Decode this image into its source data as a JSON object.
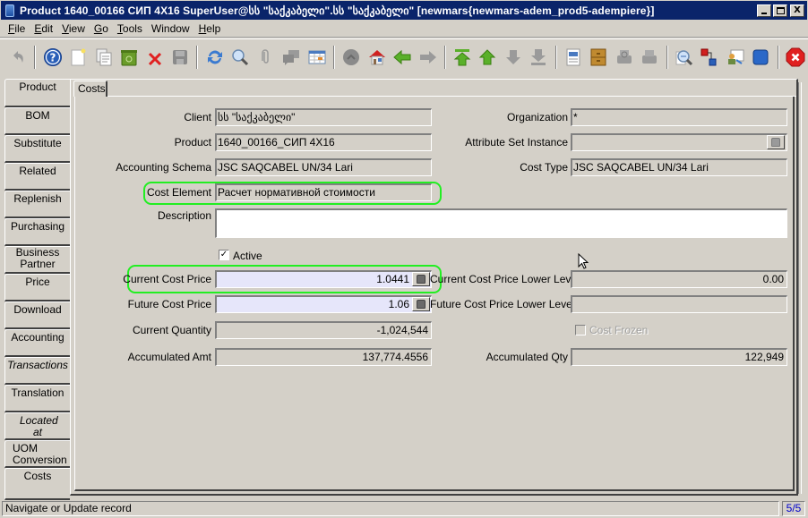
{
  "window": {
    "title": "Product  1640_00166  СИП 4X16  SuperUser@სს \"საქკაბელი\".სს \"საქკაბელი\" [newmars{newmars-adem_prod5-adempiere}]",
    "minimize": "_",
    "maximize": "□",
    "close": "X"
  },
  "menu": [
    {
      "label": "File",
      "mnemonic": "F",
      "rest": "ile"
    },
    {
      "label": "Edit",
      "mnemonic": "E",
      "rest": "dit"
    },
    {
      "label": "View",
      "mnemonic": "V",
      "rest": "iew"
    },
    {
      "label": "Go",
      "mnemonic": "G",
      "rest": "o"
    },
    {
      "label": "Tools",
      "mnemonic": "T",
      "rest": "ools"
    },
    {
      "label": "Window",
      "mnemonic": "",
      "rest": "Window"
    },
    {
      "label": "Help",
      "mnemonic": "H",
      "rest": "elp"
    }
  ],
  "toolbar": [
    {
      "icon": "undo-icon",
      "enabled": false
    },
    {
      "icon": "help-icon",
      "enabled": true
    },
    {
      "icon": "new-record-icon",
      "enabled": true
    },
    {
      "icon": "copy-record-icon",
      "enabled": true
    },
    {
      "icon": "delete-icon",
      "enabled": true
    },
    {
      "icon": "delete-selection-icon",
      "enabled": true
    },
    {
      "icon": "save-icon",
      "enabled": false
    },
    {
      "icon": "refresh-icon",
      "enabled": true
    },
    {
      "icon": "find-icon",
      "enabled": true
    },
    {
      "icon": "attachment-icon",
      "enabled": false
    },
    {
      "icon": "chat-icon",
      "enabled": false
    },
    {
      "icon": "grid-toggle-icon",
      "enabled": true
    },
    {
      "icon": "history-icon",
      "enabled": false
    },
    {
      "icon": "home-icon",
      "enabled": true
    },
    {
      "icon": "parent-icon",
      "enabled": true
    },
    {
      "icon": "detail-icon",
      "enabled": false
    },
    {
      "icon": "first-record-icon",
      "enabled": true
    },
    {
      "icon": "previous-record-icon",
      "enabled": true
    },
    {
      "icon": "next-record-icon",
      "enabled": false
    },
    {
      "icon": "last-record-icon",
      "enabled": false
    },
    {
      "icon": "report-icon",
      "enabled": true
    },
    {
      "icon": "archive-icon",
      "enabled": true
    },
    {
      "icon": "print-preview-icon",
      "enabled": false
    },
    {
      "icon": "print-icon",
      "enabled": false
    },
    {
      "icon": "zoom-across-icon",
      "enabled": true
    },
    {
      "icon": "active-workflows-icon",
      "enabled": true
    },
    {
      "icon": "request-icon",
      "enabled": true
    },
    {
      "icon": "product-info-icon",
      "enabled": true
    },
    {
      "icon": "exit-icon",
      "enabled": true
    }
  ],
  "vertical_tabs": [
    {
      "label": "Product",
      "italic": false
    },
    {
      "label": "BOM",
      "italic": false
    },
    {
      "label": "Substitute",
      "italic": false
    },
    {
      "label": "Related",
      "italic": false
    },
    {
      "label": "Replenish",
      "italic": false
    },
    {
      "label": "Purchasing",
      "italic": false
    },
    {
      "label": "Business Partner",
      "italic": false
    },
    {
      "label": "Price",
      "italic": false
    },
    {
      "label": "Download",
      "italic": false
    },
    {
      "label": "Accounting",
      "italic": false
    },
    {
      "label": "Transactions",
      "italic": true
    },
    {
      "label": "Translation",
      "italic": false
    },
    {
      "label": "Located at",
      "italic": true
    },
    {
      "label": "UOM Conversion",
      "italic": false
    },
    {
      "label": "Costs",
      "italic": false,
      "selected": true
    }
  ],
  "subtab": {
    "label": "Costs"
  },
  "form": {
    "client": {
      "label": "Client",
      "value": "სს \"საქკაბელი\""
    },
    "organization": {
      "label": "Organization",
      "value": "*"
    },
    "product": {
      "label": "Product",
      "value": "1640_00166_СИП 4X16"
    },
    "attribute_set_instance": {
      "label": "Attribute Set Instance",
      "value": ""
    },
    "accounting_schema": {
      "label": "Accounting Schema",
      "value": "JSC SAQCABEL UN/34 Lari"
    },
    "cost_type": {
      "label": "Cost Type",
      "value": "JSC SAQCABEL UN/34 Lari"
    },
    "cost_element": {
      "label": "Cost Element",
      "value": "Расчет нормативной стоимости"
    },
    "description": {
      "label": "Description",
      "value": ""
    },
    "active": {
      "label": "Active",
      "checked": true
    },
    "current_cost_price": {
      "label": "Current Cost Price",
      "value": "1.0441"
    },
    "current_cost_price_lower_level": {
      "label": "Current Cost Price Lower Level",
      "value": "0.00"
    },
    "future_cost_price": {
      "label": "Future Cost Price",
      "value": "1.06"
    },
    "future_cost_price_lower_level": {
      "label": "Future Cost Price Lower Level",
      "value": ""
    },
    "current_quantity": {
      "label": "Current Quantity",
      "value": "-1,024,544"
    },
    "cost_frozen": {
      "label": "Cost Frozen",
      "checked": false
    },
    "accumulated_amt": {
      "label": "Accumulated Amt",
      "value": "137,774.4556"
    },
    "accumulated_qty": {
      "label": "Accumulated Qty",
      "value": "122,949"
    }
  },
  "status": {
    "message": "Navigate or Update record",
    "record_count": "5/5"
  },
  "colors": {
    "title_bar": "#0a246a",
    "highlight_outline": "#22ee22",
    "mandatory_field": "#e6e6fa",
    "record_count": "#0000cc"
  }
}
